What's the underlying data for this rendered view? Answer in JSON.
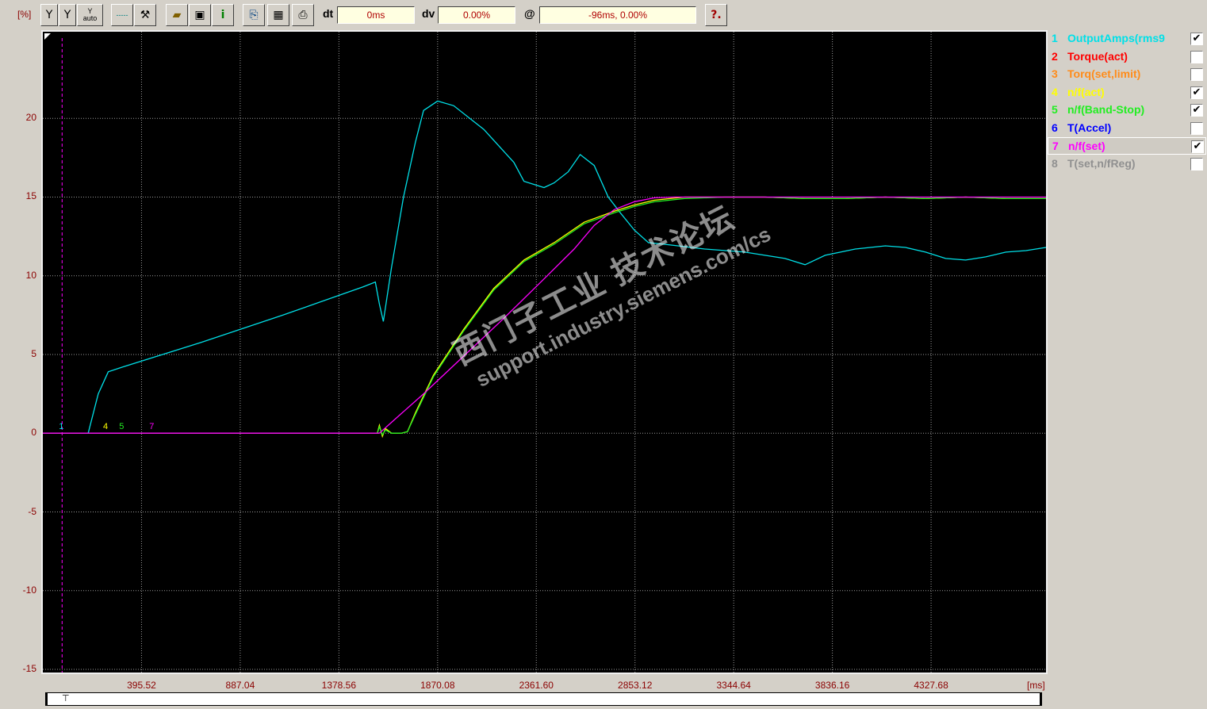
{
  "toolbar": {
    "unit": "[%]",
    "buttons": [
      {
        "name": "y-zoom-button",
        "icon": "y-fit-icon",
        "label": "Y"
      },
      {
        "name": "y-scale-button",
        "icon": "y-scale-icon",
        "label": "Y"
      },
      {
        "name": "y-auto-button",
        "icon": "y-auto-icon",
        "label": "Y",
        "sub": "auto"
      },
      {
        "name": "grid-button",
        "icon": "grid-lines-icon",
        "label": "-----"
      },
      {
        "name": "tools-button",
        "icon": "tools-icon",
        "label": "⚒"
      },
      {
        "name": "open-button",
        "icon": "folder-open-icon",
        "label": "▰"
      },
      {
        "name": "save-button",
        "icon": "floppy-icon",
        "label": "▣"
      },
      {
        "name": "info-button",
        "icon": "info-icon",
        "label": "i"
      },
      {
        "name": "export-button",
        "icon": "export-icon",
        "label": "⎘"
      },
      {
        "name": "table-button",
        "icon": "table-icon",
        "label": "▦"
      },
      {
        "name": "print-button",
        "icon": "printer-icon",
        "label": "⎙"
      },
      {
        "name": "help-button",
        "icon": "help-icon",
        "label": "?."
      }
    ],
    "dt_label": "dt",
    "dt_value": "0ms",
    "dv_label": "dv",
    "dv_value": "0.00%",
    "at_label": "@",
    "at_value": "-96ms, 0.00%"
  },
  "legend": [
    {
      "num": "1",
      "name": "OutputAmps(rms9",
      "color": "#00e0e8",
      "checked": true
    },
    {
      "num": "2",
      "name": "Torque(act)",
      "color": "#ff0000",
      "checked": false
    },
    {
      "num": "3",
      "name": "Torq(set,limit)",
      "color": "#ff8c1a",
      "checked": false
    },
    {
      "num": "4",
      "name": "n/f(act)",
      "color": "#ffff00",
      "checked": true
    },
    {
      "num": "5",
      "name": "n/f(Band-Stop)",
      "color": "#22ee22",
      "checked": true
    },
    {
      "num": "6",
      "name": "T(Accel)",
      "color": "#0000ff",
      "checked": false
    },
    {
      "num": "7",
      "name": "n/f(set)",
      "color": "#ff00ff",
      "checked": true,
      "selected": true
    },
    {
      "num": "8",
      "name": "T(set,n/fReg)",
      "color": "#909090",
      "checked": false
    }
  ],
  "watermark": {
    "line1": "西门子工业 技术论坛",
    "line2": "support.industry.siemens.com/cs"
  },
  "chart_data": {
    "type": "line",
    "ylabel": "[%]",
    "xlabel": "[ms]",
    "xlim": [
      -96,
      4900
    ],
    "ylim": [
      -15.2,
      25.5
    ],
    "grid": true,
    "x_ticks": [
      "395.52",
      "887.04",
      "1378.56",
      "1870.08",
      "2361.60",
      "2853.12",
      "3344.64",
      "3836.16",
      "4327.68"
    ],
    "x_tick_values": [
      395.52,
      887.04,
      1378.56,
      1870.08,
      2361.6,
      2853.12,
      3344.64,
      3836.16,
      4327.68
    ],
    "y_ticks": [
      "20",
      "15",
      "10",
      "5",
      "0",
      "-5",
      "-10",
      "-15"
    ],
    "y_tick_values": [
      20,
      15,
      10,
      5,
      0,
      -5,
      -10,
      -15
    ],
    "cursor_x": 0,
    "trace_markers": [
      {
        "label": "1",
        "x": 0,
        "color": "#00e0e8"
      },
      {
        "label": "4",
        "x": 220,
        "color": "#ffff00"
      },
      {
        "label": "5",
        "x": 300,
        "color": "#22ee22"
      },
      {
        "label": "7",
        "x": 450,
        "color": "#ff00ff"
      }
    ],
    "series": [
      {
        "name": "OutputAmps(rms9",
        "color": "#00e0e8",
        "x": [
          -96,
          130,
          180,
          230,
          300,
          700,
          1100,
          1500,
          1560,
          1580,
          1600,
          1640,
          1700,
          1760,
          1800,
          1870,
          1950,
          2100,
          2250,
          2300,
          2400,
          2450,
          2520,
          2580,
          2650,
          2720,
          2780,
          2850,
          2920,
          3000,
          3200,
          3400,
          3600,
          3700,
          3800,
          3950,
          4100,
          4200,
          4300,
          4400,
          4500,
          4600,
          4700,
          4800,
          4900
        ],
        "y": [
          0,
          0,
          2.5,
          3.9,
          4.2,
          5.8,
          7.5,
          9.3,
          9.6,
          8.2,
          7.1,
          10.5,
          15.0,
          18.5,
          20.5,
          21.1,
          20.8,
          19.3,
          17.2,
          16.0,
          15.6,
          15.9,
          16.6,
          17.7,
          17.0,
          15.0,
          14.0,
          12.9,
          12.1,
          12.0,
          11.7,
          11.5,
          11.1,
          10.7,
          11.3,
          11.7,
          11.9,
          11.8,
          11.5,
          11.1,
          11.0,
          11.2,
          11.5,
          11.6,
          11.8
        ]
      },
      {
        "name": "n/f(act)",
        "color": "#ffff00",
        "x": [
          -96,
          1570,
          1580,
          1595,
          1610,
          1640,
          1690,
          1720,
          1760,
          1850,
          2000,
          2150,
          2300,
          2450,
          2600,
          2750,
          2850,
          2950,
          3100,
          3300,
          3500,
          3700,
          3900,
          4100,
          4300,
          4500,
          4700,
          4900
        ],
        "y": [
          0,
          0,
          0.5,
          -0.2,
          0.3,
          0,
          0,
          0.1,
          1.3,
          3.7,
          6.6,
          9.2,
          11.0,
          12.1,
          13.4,
          14.1,
          14.5,
          14.8,
          15.0,
          15.0,
          15.0,
          14.9,
          14.9,
          15.0,
          14.9,
          15.0,
          14.9,
          14.9
        ]
      },
      {
        "name": "n/f(Band-Stop)",
        "color": "#22ee22",
        "x": [
          -96,
          1570,
          1580,
          1595,
          1610,
          1640,
          1690,
          1720,
          1760,
          1850,
          2000,
          2150,
          2300,
          2450,
          2600,
          2750,
          2850,
          2950,
          3100,
          3300,
          3500,
          3700,
          3900,
          4100,
          4300,
          4500,
          4700,
          4900
        ],
        "y": [
          0,
          0,
          0.4,
          -0.1,
          0.2,
          0,
          0,
          0.1,
          1.2,
          3.6,
          6.5,
          9.1,
          10.9,
          12.0,
          13.3,
          14.0,
          14.4,
          14.7,
          14.9,
          15.0,
          15.0,
          14.9,
          14.9,
          15.0,
          14.9,
          15.0,
          14.9,
          14.9
        ]
      },
      {
        "name": "n/f(set)",
        "color": "#ff00ff",
        "x": [
          -96,
          1580,
          1650,
          1800,
          2000,
          2200,
          2400,
          2550,
          2650,
          2750,
          2850,
          2950,
          3050,
          3200,
          3400,
          3600,
          3800,
          4000,
          4200,
          4400,
          4600,
          4900
        ],
        "y": [
          0,
          0,
          0.8,
          2.5,
          4.9,
          7.3,
          9.8,
          11.7,
          13.2,
          14.2,
          14.7,
          14.95,
          15.0,
          15.0,
          15.0,
          15.0,
          15.0,
          15.0,
          15.0,
          15.0,
          15.0,
          15.0
        ]
      }
    ]
  }
}
